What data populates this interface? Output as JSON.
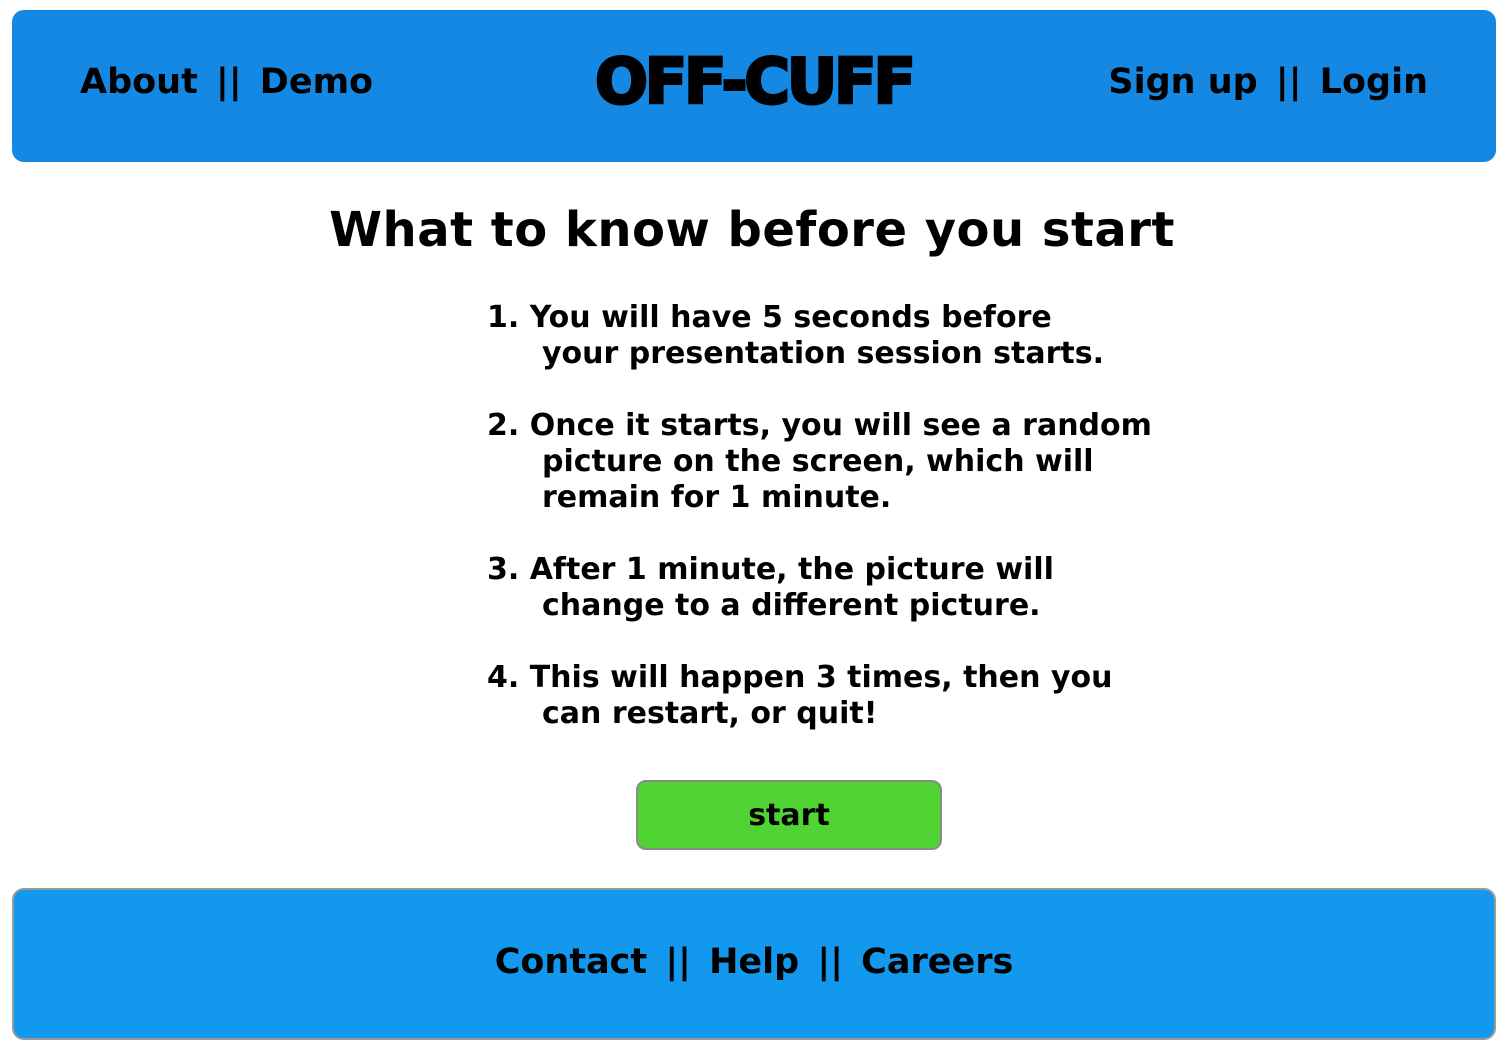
{
  "header": {
    "logo": "OFF-CUFF",
    "left_links": [
      "About",
      "Demo"
    ],
    "right_links": [
      "Sign up",
      "Login"
    ],
    "separator": "||",
    "background": "#1588e3"
  },
  "main": {
    "title": "What to know before you start",
    "steps": [
      "1. You will have 5 seconds before\nyour presentation session starts.",
      "2. Once it starts, you will see a random\npicture on the screen, which will\nremain for 1 minute.",
      "3. After 1 minute, the picture will\nchange to a different picture.",
      "4. This will happen 3 times, then you\ncan restart, or quit!"
    ],
    "start_label": "start",
    "start_color": "#4fd434"
  },
  "footer": {
    "links": [
      "Contact",
      "Help",
      "Careers"
    ],
    "separator": "||",
    "background": "#1299ee"
  }
}
